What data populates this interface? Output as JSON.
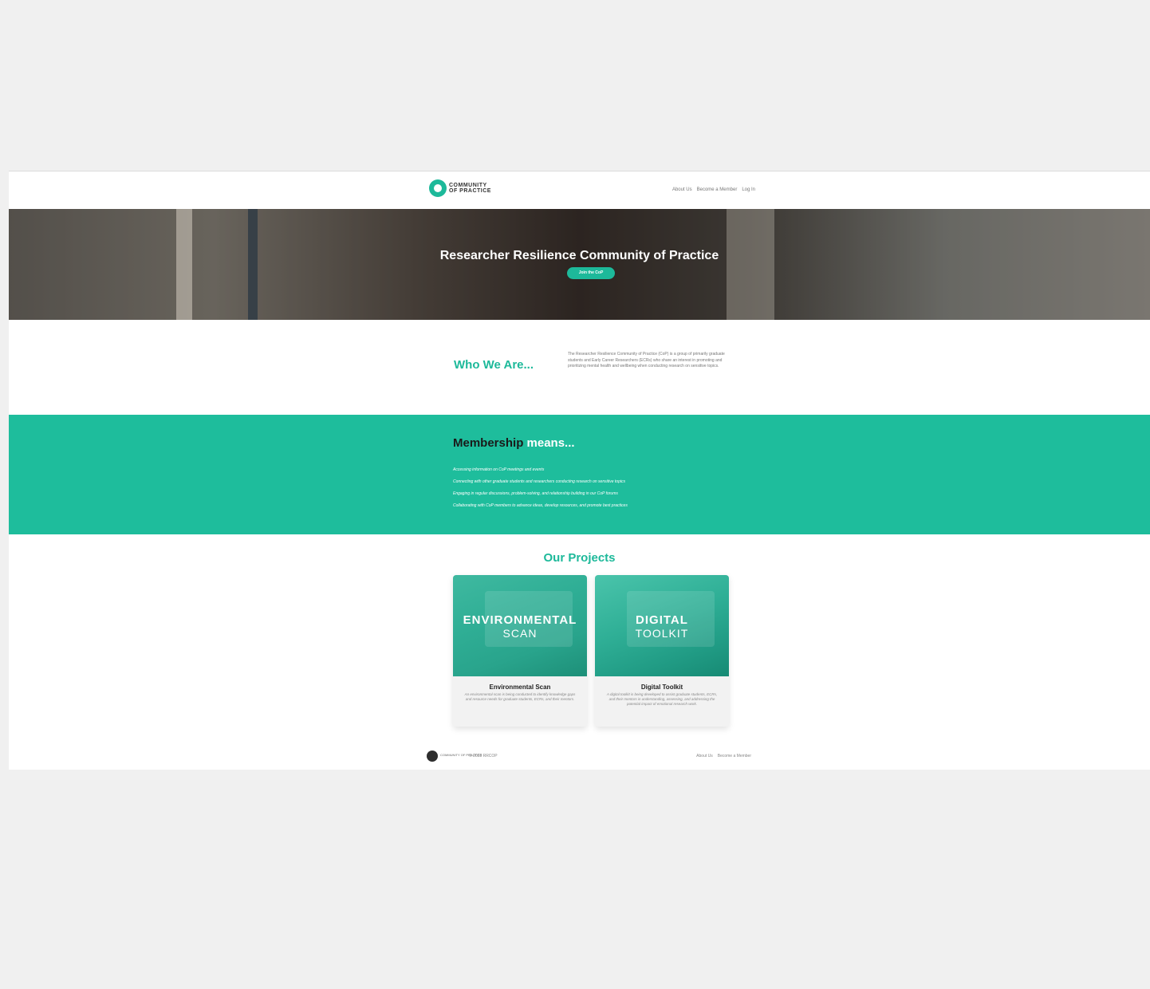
{
  "nav": {
    "logo_line1": "COMMUNITY",
    "logo_line2": "OF PRACTICE",
    "links": [
      "About Us",
      "Become a Member",
      "Log In"
    ]
  },
  "hero": {
    "title": "Researcher Resilience Community of Practice",
    "button": "Join the CoP"
  },
  "who": {
    "title": "Who We Are...",
    "text": "The Researcher Resilience Community of Practice (CoP) is a group of primarily graduate students and Early Career Researchers (ECRs) who share an interest in promoting and prioritizing mental health and wellbeing when conducting research on sensitive topics."
  },
  "membership": {
    "title_a": "Membership",
    "title_b": "means...",
    "items": [
      "Accessing information on CoP meetings and events",
      "Connecting with other graduate students and researchers conducting research on sensitive topics",
      "Engaging in regular discussions, problem-solving, and relationship building in our CoP forums",
      "Collaborating with CoP members to advance ideas, develop resources, and promote best practices"
    ]
  },
  "projects": {
    "title": "Our Projects",
    "cards": [
      {
        "overlay1": "ENVIRONMENTAL",
        "overlay2": "SCAN",
        "title": "Environmental Scan",
        "desc": "An environmental scan is being conducted to identify knowledge gaps and resource needs for graduate students, ECRs, and their mentors."
      },
      {
        "overlay1": "DIGITAL",
        "overlay2": "TOOLKIT",
        "title": "Digital Toolkit",
        "desc": "A digital toolkit is being developed to assist graduate students, ECRs, and their mentors in understanding, assessing, and addressing the potential impact of emotional research work."
      }
    ]
  },
  "footer": {
    "logo_text": "COMMUNITY OF PRACTICE",
    "copyright": "© 2023 RRCOP",
    "links": [
      "About Us",
      "Become a Member"
    ]
  },
  "colors": {
    "accent": "#1db99a",
    "membership_bg": "#1ebd9c",
    "canvas": "#f0f0f0"
  }
}
